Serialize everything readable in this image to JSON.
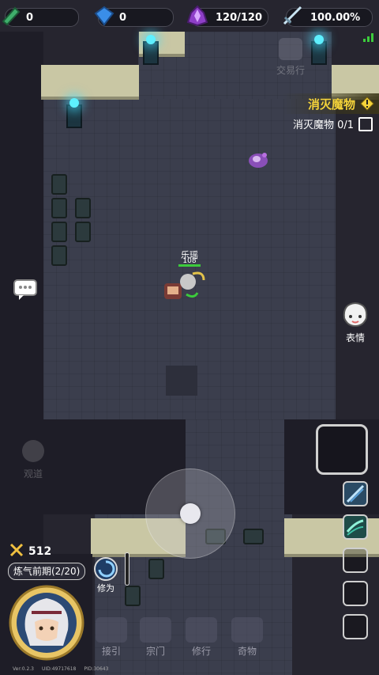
{
  "hud": {
    "jade": {
      "icon": "green-jade-icon",
      "value": "0"
    },
    "gem": {
      "icon": "blue-gem-icon",
      "value": "0"
    },
    "stamina": {
      "icon": "purple-crystal-icon",
      "value": "120/120"
    },
    "sword": {
      "icon": "sword-icon",
      "value": "100.00%"
    }
  },
  "trade_label": "交易行",
  "quest": {
    "title": "消灭魔物",
    "item": "消灭魔物 0/1"
  },
  "player": {
    "name": "乐瑶",
    "hp": "108"
  },
  "emote_label": "表情",
  "power": {
    "value": "512"
  },
  "realm": "炼气前期(2/20)",
  "cultivate_label": "修为",
  "faded_label": "观道",
  "nav": {
    "items": [
      "接引",
      "宗门",
      "修行",
      "奇物"
    ]
  },
  "version": {
    "ver": "Ver:0.2.3",
    "uid": "UID:49717618",
    "pid": "PID:30643"
  },
  "colors": {
    "accent": "#f4d33a",
    "floor": "#3b3e4d",
    "wall_top": "#c9c7a4",
    "lamp": "#5ef0ff"
  }
}
